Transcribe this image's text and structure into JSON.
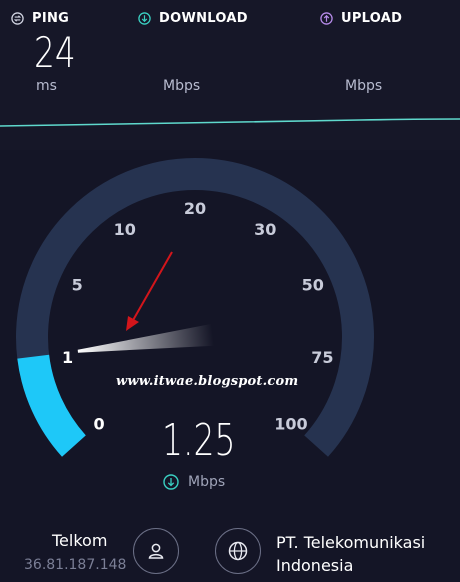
{
  "metrics": {
    "ping": {
      "label": "PING",
      "value": "24",
      "unit": "ms",
      "icon": "ping-icon"
    },
    "download": {
      "label": "DOWNLOAD",
      "unit": "Mbps",
      "icon": "download-arrow-icon"
    },
    "upload": {
      "label": "UPLOAD",
      "unit": "Mbps",
      "icon": "upload-arrow-icon"
    }
  },
  "gauge": {
    "ticks": [
      "0",
      "1",
      "5",
      "10",
      "20",
      "30",
      "50",
      "75",
      "100"
    ],
    "current_speed": 1.25
  },
  "result": {
    "speed": "1.25",
    "unit": "Mbps",
    "icon": "download-arrow-icon"
  },
  "watermark": "www.itwae.blogspot.com",
  "isp": {
    "name": "Telkom",
    "ip": "36.81.187.148",
    "icon": "user-icon"
  },
  "server": {
    "line1": "PT. Telekomunikasi",
    "line2": "Indonesia",
    "icon": "globe-icon"
  },
  "colors": {
    "accent_cyan": "#1ec8f8",
    "ping_icon": "#cfd2e0",
    "download_icon": "#3ad0c2",
    "upload_icon": "#b58ae8",
    "gauge_track": "#263350"
  }
}
